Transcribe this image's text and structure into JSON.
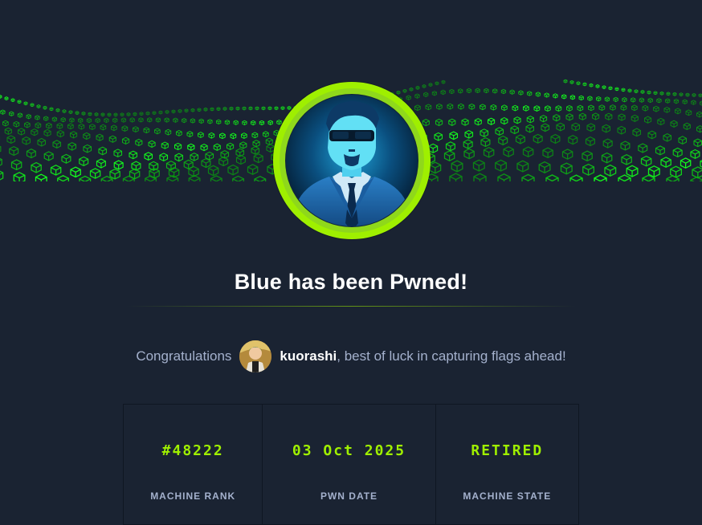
{
  "pwn": {
    "title": "Blue has been Pwned!",
    "congrats_prefix": "Congratulations",
    "username": "kuorashi",
    "congrats_suffix": ", best of luck in capturing flags ahead!"
  },
  "stats": [
    {
      "value": "#48222",
      "label": "MACHINE RANK"
    },
    {
      "value": "03 Oct 2025",
      "label": "PWN DATE"
    },
    {
      "value": "RETIRED",
      "label": "MACHINE STATE"
    }
  ],
  "colors": {
    "background": "#1a2332",
    "accent": "#9fef00",
    "text_muted": "#a4b1cd",
    "text_white": "#ffffff"
  },
  "icons": {
    "machine_avatar": "agent-with-sunglasses-avatar",
    "user_avatar": "user-avatar"
  }
}
